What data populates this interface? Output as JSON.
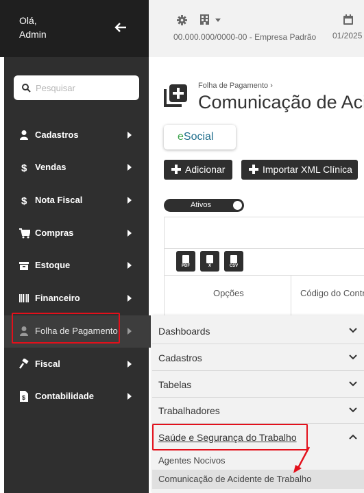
{
  "sidebar": {
    "greeting": "Olá,",
    "user": "Admin",
    "search_placeholder": "Pesquisar",
    "items": [
      {
        "label": "Cadastros",
        "icon": "user-icon"
      },
      {
        "label": "Vendas",
        "icon": "dollar-icon"
      },
      {
        "label": "Nota Fiscal",
        "icon": "dollar-icon"
      },
      {
        "label": "Compras",
        "icon": "cart-icon"
      },
      {
        "label": "Estoque",
        "icon": "box-icon"
      },
      {
        "label": "Financeiro",
        "icon": "barcode-icon"
      },
      {
        "label": "Folha de Pagamento",
        "icon": "user-icon"
      },
      {
        "label": "Fiscal",
        "icon": "gavel-icon"
      },
      {
        "label": "Contabilidade",
        "icon": "file-dollar-icon"
      }
    ]
  },
  "header": {
    "company": "00.000.000/0000-00 - Empresa Padrão",
    "period": "01/2025"
  },
  "main": {
    "breadcrumb": "Folha de Pagamento",
    "title": "Comunicação de Acidente de Trabalho",
    "esocial_e": "e",
    "esocial_label": "Social",
    "add_button": "Adicionar",
    "import_button": "Importar XML Clínica",
    "filter_toggle": "Ativos",
    "export_buttons": [
      "PDF",
      "X",
      "CSV"
    ],
    "columns": [
      "Opções",
      "Código do Contrato"
    ]
  },
  "submenu": {
    "sections": [
      "Dashboards",
      "Cadastros",
      "Tabelas",
      "Trabalhadores",
      "Saúde e Segurança do Trabalho"
    ],
    "expanded_items": [
      "Agentes Nocivos",
      "Comunicação de Acidente de Trabalho"
    ]
  },
  "colors": {
    "sidebar_dark": "#1f1f1f",
    "sidebar": "#2f2f2f",
    "highlight": "#e3101b",
    "esocial_green": "#3aa34a",
    "esocial_blue": "#1f6e8c"
  }
}
